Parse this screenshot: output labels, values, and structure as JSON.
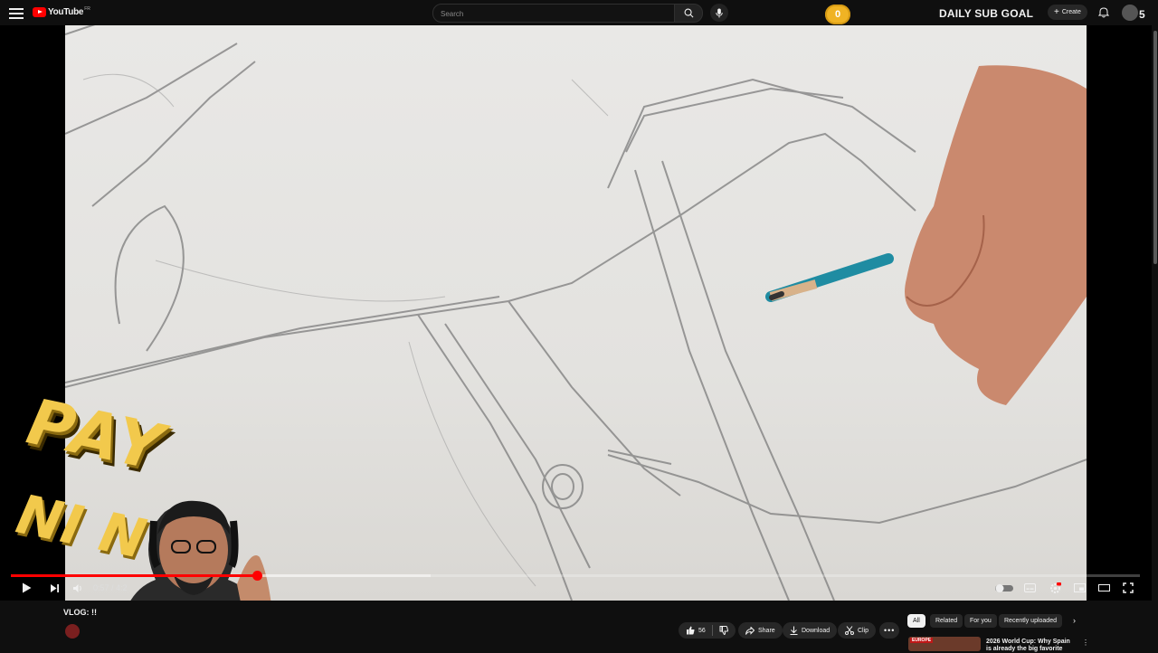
{
  "header": {
    "logo_text": "YouTube",
    "region": "FR",
    "search_placeholder": "Search",
    "sub_badge": "0",
    "sub_goal": "DAILY SUB GOAL",
    "create_label": "Create",
    "sub_count": "5"
  },
  "overlay": {
    "pay_text": "PAY",
    "nin_text": "NI  N"
  },
  "player": {
    "current_time": "0:57",
    "duration": "4:2",
    "time_sep": " / ",
    "played_fraction": 0.218,
    "buffered_fraction": 0.372
  },
  "below": {
    "title": "VLOG: !! ",
    "actions": {
      "likes": "56",
      "share": "Share",
      "download": "Download",
      "clip": "Clip"
    },
    "chips": [
      "All",
      "Related",
      "For you",
      "Recently uploaded"
    ],
    "rec_tag": "EUROPE",
    "rec_title": "2026 World Cup: Why Spain is already the big favorite"
  },
  "colors": {
    "accent": "#ff0000",
    "background": "#0f0f0f",
    "sub_badge": "#f0b324",
    "overlay_text": "#f2c94c"
  }
}
